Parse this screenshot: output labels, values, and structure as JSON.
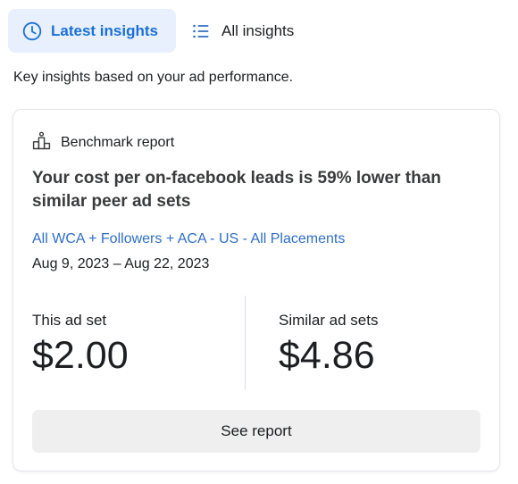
{
  "tabs": {
    "latest": {
      "label": "Latest insights",
      "icon": "clock-icon",
      "active": true
    },
    "all": {
      "label": "All insights",
      "icon": "list-icon",
      "active": false
    }
  },
  "intro_text": "Key insights based on your ad performance.",
  "card": {
    "header": {
      "icon": "podium-icon",
      "label": "Benchmark report"
    },
    "headline": "Your cost per on-facebook leads is 59% lower than similar peer ad sets",
    "adset_name": "All WCA + Followers + ACA - US - All Placements",
    "date_range": "Aug 9, 2023 – Aug 22, 2023",
    "metrics": {
      "this": {
        "label": "This ad set",
        "value": "$2.00"
      },
      "similar": {
        "label": "Similar ad sets",
        "value": "$4.86"
      }
    },
    "button_label": "See report"
  },
  "colors": {
    "accent": "#1b6fd7",
    "link": "#2f6ec6",
    "active_tab_bg": "#e7f0fc",
    "button_bg": "#efefef"
  }
}
